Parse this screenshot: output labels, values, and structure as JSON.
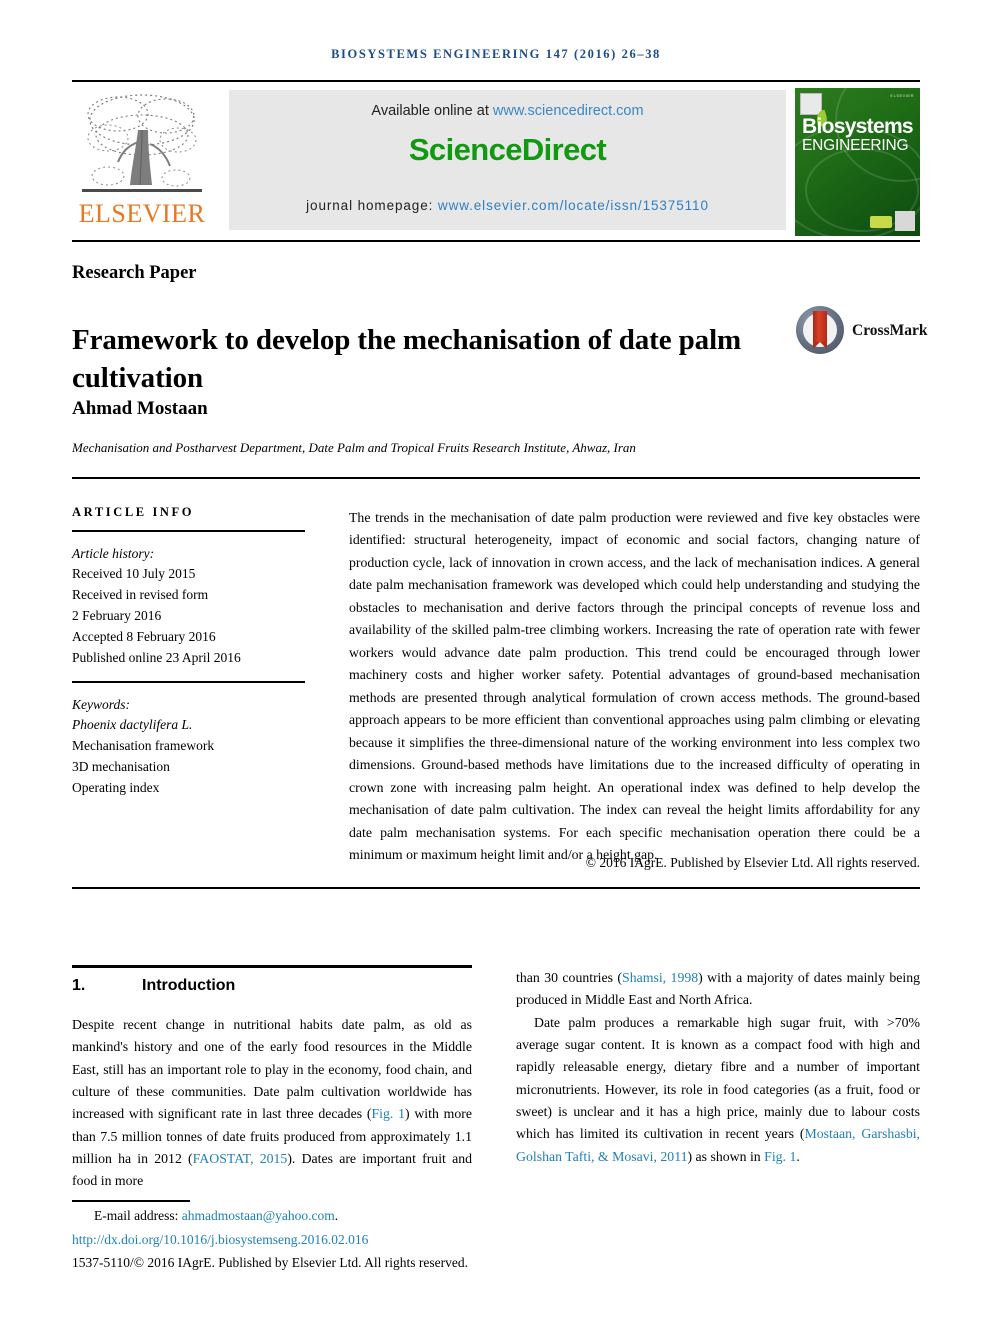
{
  "running_head": "BIOSYSTEMS ENGINEERING 147 (2016) 26–38",
  "masthead": {
    "elsevier_wordmark": "ELSEVIER",
    "available_online_prefix": "Available online at ",
    "sciencedirect_url": "www.sciencedirect.com",
    "sciencedirect_wordmark": "ScienceDirect",
    "journal_homepage_label": "journal homepage: ",
    "journal_homepage_url": "www.elsevier.com/locate/issn/15375110",
    "cover": {
      "line1": "Biosystems",
      "line2": "ENGINEERING",
      "top_text": "ELSEVIER"
    }
  },
  "article": {
    "type": "Research Paper",
    "title": "Framework to develop the mechanisation of date palm cultivation",
    "crossmark_label": "CrossMark",
    "author": "Ahmad Mostaan",
    "affiliation": "Mechanisation and Postharvest Department, Date Palm and Tropical Fruits Research Institute, Ahwaz, Iran"
  },
  "article_info": {
    "heading": "ARTICLE INFO",
    "history_label": "Article history:",
    "history": [
      "Received 10 July 2015",
      "Received in revised form",
      "2 February 2016",
      "Accepted 8 February 2016",
      "Published online 23 April 2016"
    ],
    "keywords_label": "Keywords:",
    "keywords": [
      "Phoenix dactylifera L.",
      "Mechanisation framework",
      "3D mechanisation",
      "Operating index"
    ]
  },
  "abstract": {
    "text": "The trends in the mechanisation of date palm production were reviewed and five key obstacles were identified: structural heterogeneity, impact of economic and social factors, changing nature of production cycle, lack of innovation in crown access, and the lack of mechanisation indices. A general date palm mechanisation framework was developed which could help understanding and studying the obstacles to mechanisation and derive factors through the principal concepts of revenue loss and availability of the skilled palm-tree climbing workers. Increasing the rate of operation rate with fewer workers would advance date palm production. This trend could be encouraged through lower machinery costs and higher worker safety. Potential advantages of ground-based mechanisation methods are presented through analytical formulation of crown access methods. The ground-based approach appears to be more efficient than conventional approaches using palm climbing or elevating because it simplifies the three-dimensional nature of the working environment into less complex two dimensions. Ground-based methods have limitations due to the increased difficulty of operating in crown zone with increasing palm height. An operational index was defined to help develop the mechanisation of date palm cultivation. The index can reveal the height limits affordability for any date palm mechanisation systems. For each specific mechanisation operation there could be a minimum or maximum height limit and/or a height gap.",
    "copyright": "© 2016 IAgrE. Published by Elsevier Ltd. All rights reserved."
  },
  "introduction": {
    "number": "1.",
    "title": "Introduction",
    "left_column_parts": {
      "p1_a": "Despite recent change in nutritional habits date palm, as old as mankind's history and one of the early food resources in the Middle East, still has an important role to play in the economy, food chain, and culture of these communities. Date palm cultivation worldwide has increased with significant rate in last three decades (",
      "fig1_link": "Fig. 1",
      "p1_b": ") with more than 7.5 million tonnes of date fruits produced from approximately 1.1 million ha in 2012 (",
      "faostat_link": "FAOSTAT, 2015",
      "p1_c": "). Dates are important fruit and food in more"
    },
    "right_column_parts": {
      "p1_a": "than 30 countries (",
      "shamsi_link": "Shamsi, 1998",
      "p1_b": ") with a majority of dates mainly being produced in Middle East and North Africa.",
      "p2_a": "Date palm produces a remarkable high sugar fruit, with >70% average sugar content. It is known as a compact food with high and rapidly releasable energy, dietary fibre and a number of important micronutrients. However, its role in food categories (as a fruit, food or sweet) is unclear and it has a high price, mainly due to labour costs which has limited its cultivation in recent years (",
      "mostaan_link": "Mostaan, Garshasbi, Golshan Tafti, & Mosavi, 2011",
      "p2_b": ") as shown in ",
      "fig1_link": "Fig. 1",
      "p2_c": "."
    }
  },
  "footer": {
    "email_label": "E-mail address:",
    "email": "ahmadmostaan@yahoo.com",
    "email_suffix": ".",
    "doi": "http://dx.doi.org/10.1016/j.biosystemseng.2016.02.016",
    "issn_line": "1537-5110/© 2016 IAgrE. Published by Elsevier Ltd. All rights reserved."
  },
  "colors": {
    "link": "#1f80b5",
    "elsevier_orange": "#E87722",
    "sciencedirect_green": "#119911",
    "running_head_blue": "#1a4c8b"
  }
}
